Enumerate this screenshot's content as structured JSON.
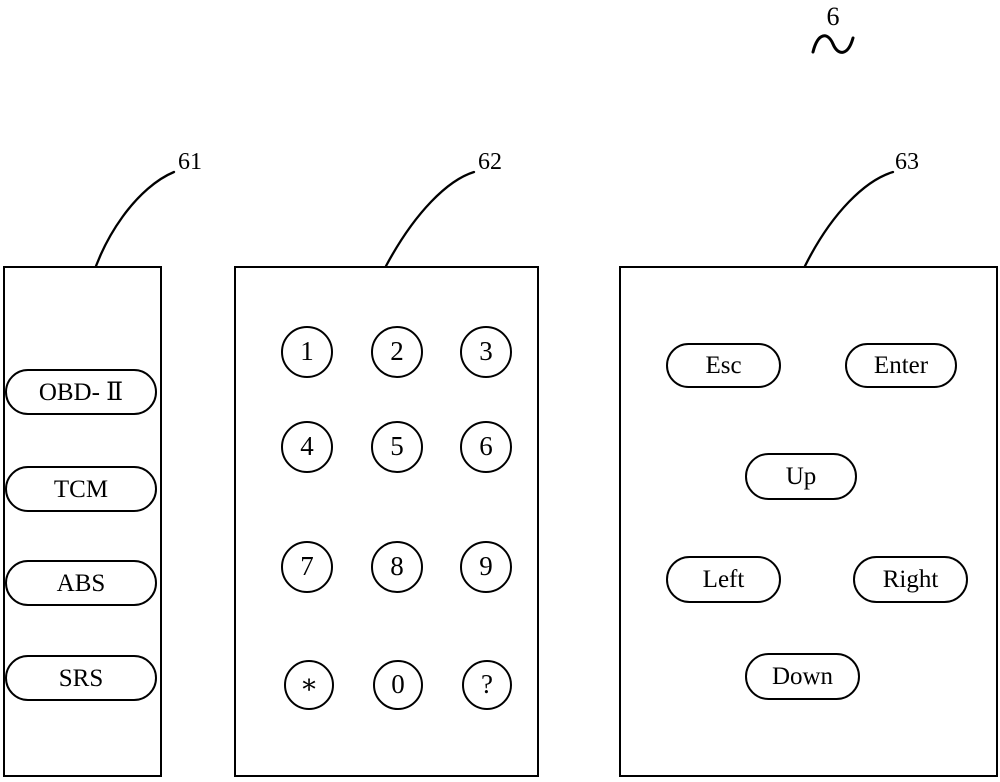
{
  "figure": {
    "number": "6",
    "squiggle_icon": "tilde-squiggle-icon"
  },
  "reference_numerals": {
    "functions_panel": "61",
    "keypad_panel": "62",
    "navigation_panel": "63"
  },
  "functions_panel": {
    "name": "diagnostic-function-menu",
    "buttons": [
      {
        "id": "obd2",
        "label": "OBD- Ⅱ"
      },
      {
        "id": "tcm",
        "label": "TCM"
      },
      {
        "id": "abs",
        "label": "ABS"
      },
      {
        "id": "srs",
        "label": "SRS"
      }
    ]
  },
  "keypad_panel": {
    "name": "numeric-keypad",
    "rows": [
      [
        {
          "id": "key-1",
          "label": "1"
        },
        {
          "id": "key-2",
          "label": "2"
        },
        {
          "id": "key-3",
          "label": "3"
        }
      ],
      [
        {
          "id": "key-4",
          "label": "4"
        },
        {
          "id": "key-5",
          "label": "5"
        },
        {
          "id": "key-6",
          "label": "6"
        }
      ],
      [
        {
          "id": "key-7",
          "label": "7"
        },
        {
          "id": "key-8",
          "label": "8"
        },
        {
          "id": "key-9",
          "label": "9"
        }
      ],
      [
        {
          "id": "key-star",
          "label": "∗"
        },
        {
          "id": "key-0",
          "label": "0"
        },
        {
          "id": "key-question",
          "label": "?"
        }
      ]
    ]
  },
  "navigation_panel": {
    "name": "navigation-keypad",
    "buttons": [
      {
        "id": "esc",
        "label": "Esc"
      },
      {
        "id": "enter",
        "label": "Enter"
      },
      {
        "id": "up",
        "label": "Up"
      },
      {
        "id": "left",
        "label": "Left"
      },
      {
        "id": "right",
        "label": "Right"
      },
      {
        "id": "down",
        "label": "Down"
      }
    ]
  },
  "colors": {
    "stroke": "#000000",
    "background": "#ffffff"
  }
}
